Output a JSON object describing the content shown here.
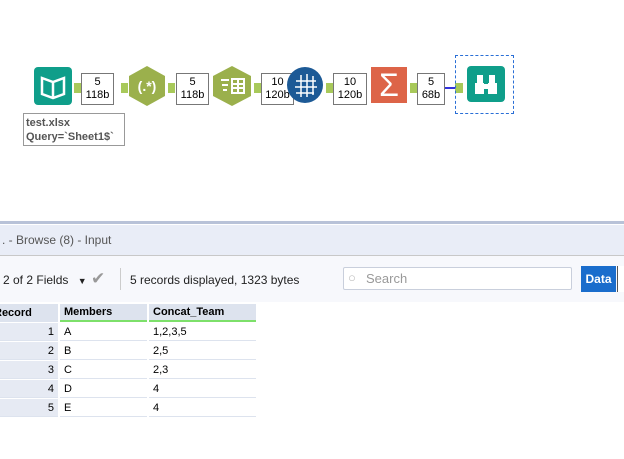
{
  "workflow": {
    "badges": [
      {
        "count": "5",
        "size": "118b"
      },
      {
        "count": "5",
        "size": "118b"
      },
      {
        "count": "10",
        "size": "120b"
      },
      {
        "count": "10",
        "size": "120b"
      },
      {
        "count": "5",
        "size": "68b"
      }
    ],
    "annotation": {
      "line1": "test.xlsx",
      "line2": "Query=`Sheet1$`"
    },
    "regex_label": "(.*)",
    "colors": {
      "input": "#0f9e8a",
      "regex": "#9bb04c",
      "sigma": "#dd6448",
      "globe": "#1d5a96"
    }
  },
  "results": {
    "title": ". - Browse (8) - Input",
    "fields_selector": "2 of 2 Fields",
    "status": "5 records displayed, 1323 bytes",
    "search_placeholder": "Search",
    "data_tab": "Data",
    "columns": [
      "Record",
      "Members",
      "Concat_Team"
    ],
    "rows": [
      [
        "1",
        "A",
        "1,2,3,5"
      ],
      [
        "2",
        "B",
        "2,5"
      ],
      [
        "3",
        "C",
        "2,3"
      ],
      [
        "4",
        "D",
        "4"
      ],
      [
        "5",
        "E",
        "4"
      ]
    ]
  }
}
